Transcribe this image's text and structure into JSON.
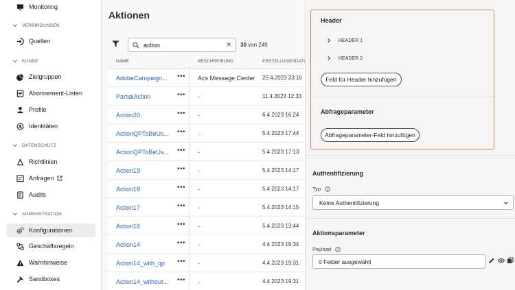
{
  "sidebar": {
    "items": [
      {
        "label": "Monitoring",
        "icon": "monitor-icon"
      },
      {
        "label": "Quellen",
        "icon": "sources-icon"
      },
      {
        "label": "Zielgruppen",
        "icon": "segments-icon"
      },
      {
        "label": "Abonnement-Listen",
        "icon": "list-icon"
      },
      {
        "label": "Profile",
        "icon": "person-icon"
      },
      {
        "label": "Identitäten",
        "icon": "identity-icon"
      },
      {
        "label": "Richtlinien",
        "icon": "policy-icon"
      },
      {
        "label": "Anfragen",
        "icon": "requests-icon"
      },
      {
        "label": "Audits",
        "icon": "audit-icon"
      },
      {
        "label": "Konfigurationen",
        "icon": "gears-icon"
      },
      {
        "label": "Geschäftsregeln",
        "icon": "rules-icon"
      },
      {
        "label": "Warnhinweise",
        "icon": "alert-icon"
      },
      {
        "label": "Sandboxes",
        "icon": "sandbox-icon"
      }
    ],
    "sections": [
      "VERBINDUNGEN",
      "KUNDE",
      "DATENSCHUTZ",
      "ADMINISTRATION"
    ]
  },
  "main": {
    "title": "Aktionen",
    "search_value": "action",
    "count_shown": "30",
    "count_total": "von 249",
    "columns": [
      "NAME",
      "BESCHREIBUNG",
      "ERSTELLUNGSDATU"
    ],
    "rows": [
      {
        "name": "AdobeCampaign...",
        "desc": "Acs Message Center",
        "date": "25.4.2023 23:16"
      },
      {
        "name": "PartialAction",
        "desc": "-",
        "date": "11.4.2023 12:33"
      },
      {
        "name": "Action20",
        "desc": "-",
        "date": "6.4.2023 16:24"
      },
      {
        "name": "ActionQPToBeUs...",
        "desc": "-",
        "date": "5.4.2023 17:44"
      },
      {
        "name": "ActionQPToBeUs...",
        "desc": "-",
        "date": "5.4.2023 17:13"
      },
      {
        "name": "Action19",
        "desc": "-",
        "date": "5.4.2023 14:17"
      },
      {
        "name": "Action18",
        "desc": "-",
        "date": "5.4.2023 14:17"
      },
      {
        "name": "Action17",
        "desc": "-",
        "date": "5.4.2023 14:15"
      },
      {
        "name": "Action16",
        "desc": "-",
        "date": "5.4.2023 13:44"
      },
      {
        "name": "Action14",
        "desc": "-",
        "date": "4.4.2023 19:34"
      },
      {
        "name": "Action14_with_qp",
        "desc": "-",
        "date": "4.4.2023 19:31"
      },
      {
        "name": "Action14_without...",
        "desc": "-",
        "date": "4.4.2023 19:31"
      }
    ],
    "more_glyph": "•••"
  },
  "panel": {
    "header_title": "Header",
    "header_items": [
      "HEADER 1",
      "HEADER 2"
    ],
    "add_header_btn": "Feld für Header hinzufügen",
    "query_title": "Abfrageparameter",
    "add_query_btn": "Abfrageparameter-Feld hinzufügen",
    "auth_title": "Authentifizierung",
    "type_label": "Typ",
    "auth_value": "Keine Authentifizierung",
    "action_params_title": "Aktionsparameter",
    "payload_label": "Payload",
    "payload_value": "0 Felder ausgewählt"
  },
  "colors": {
    "link": "#2d63b8",
    "highlight_border": "#c98363"
  }
}
